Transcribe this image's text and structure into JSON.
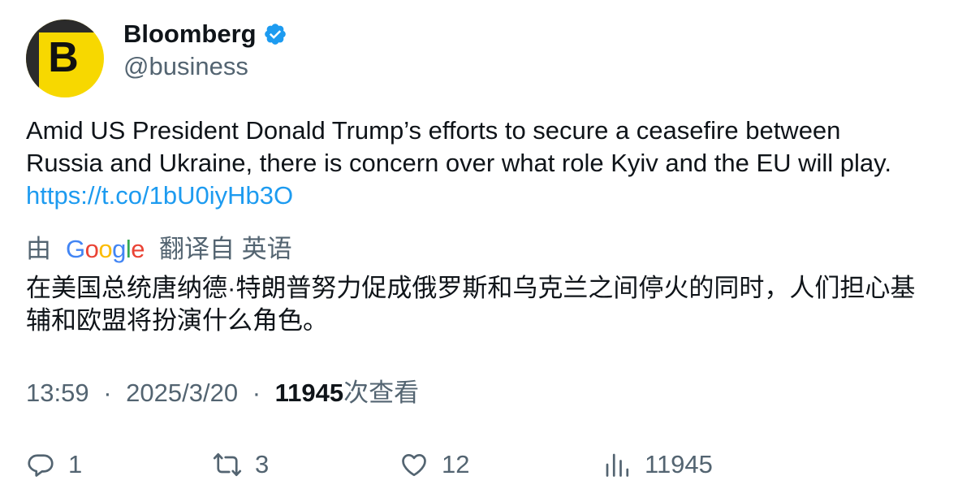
{
  "account": {
    "display_name": "Bloomberg",
    "handle": "@business",
    "avatar_letter": "B",
    "verified": true,
    "avatar_color": "#f7d800",
    "verified_color": "#1d9bf0"
  },
  "tweet": {
    "text_lines": [
      "Amid US President Donald Trump’s efforts to secure a ceasefire between",
      "Russia and Ukraine, there is concern over what role Kyiv and the EU will play."
    ],
    "link": "https://t.co/1bU0iyHb3O",
    "link_color": "#1d9bf0"
  },
  "translation": {
    "prefix": "由",
    "provider": "Google",
    "suffix": "翻译自 英语",
    "text_lines": [
      "在美国总统唐纳德·特朗普努力促成俄罗斯和乌克兰之间停火的同时，人们担心基",
      "辅和欧盟将扮演什么角色。"
    ]
  },
  "meta": {
    "time": "13:59",
    "separator": "·",
    "date": "2025/3/20",
    "views_count": "11945",
    "views_label": "次查看"
  },
  "actions": {
    "reply": {
      "icon": "reply-icon",
      "count": "1"
    },
    "retweet": {
      "icon": "retweet-icon",
      "count": "3"
    },
    "like": {
      "icon": "heart-icon",
      "count": "12"
    },
    "views": {
      "icon": "views-icon",
      "count": "11945"
    }
  }
}
